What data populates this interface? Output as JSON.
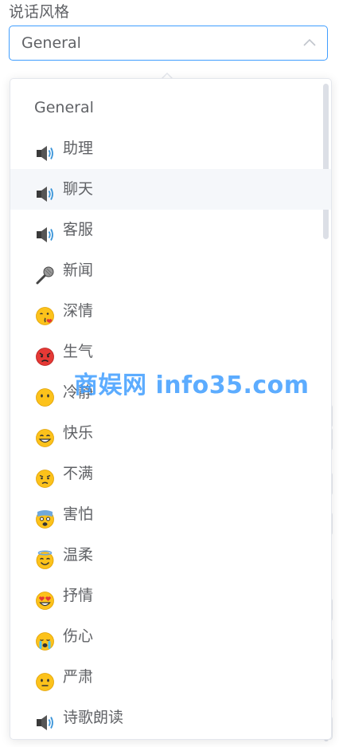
{
  "form": {
    "label": "说话风格",
    "select": {
      "value": "General"
    }
  },
  "dropdown": {
    "group_title": "General",
    "options": [
      {
        "label": "助理",
        "icon": "speaker-icon"
      },
      {
        "label": "聊天",
        "icon": "speaker-icon",
        "hover": true
      },
      {
        "label": "客服",
        "icon": "speaker-icon"
      },
      {
        "label": "新闻",
        "icon": "microphone-icon"
      },
      {
        "label": "深情",
        "icon": "kissing-face-icon"
      },
      {
        "label": "生气",
        "icon": "angry-face-icon"
      },
      {
        "label": "冷静",
        "icon": "calm-face-icon"
      },
      {
        "label": "快乐",
        "icon": "grinning-face-icon"
      },
      {
        "label": "不满",
        "icon": "annoyed-face-icon"
      },
      {
        "label": "害怕",
        "icon": "fearful-face-icon"
      },
      {
        "label": "温柔",
        "icon": "smiling-halo-face-icon"
      },
      {
        "label": "抒情",
        "icon": "heart-eyes-face-icon"
      },
      {
        "label": "伤心",
        "icon": "crying-face-icon"
      },
      {
        "label": "严肃",
        "icon": "neutral-face-icon"
      },
      {
        "label": "诗歌朗读",
        "icon": "speaker-icon"
      }
    ]
  },
  "watermark": "商娱网 info35.com",
  "colors": {
    "accent": "#409eff",
    "text": "#606266",
    "hover_bg": "#f5f7fa",
    "border": "#e4e7ed"
  }
}
